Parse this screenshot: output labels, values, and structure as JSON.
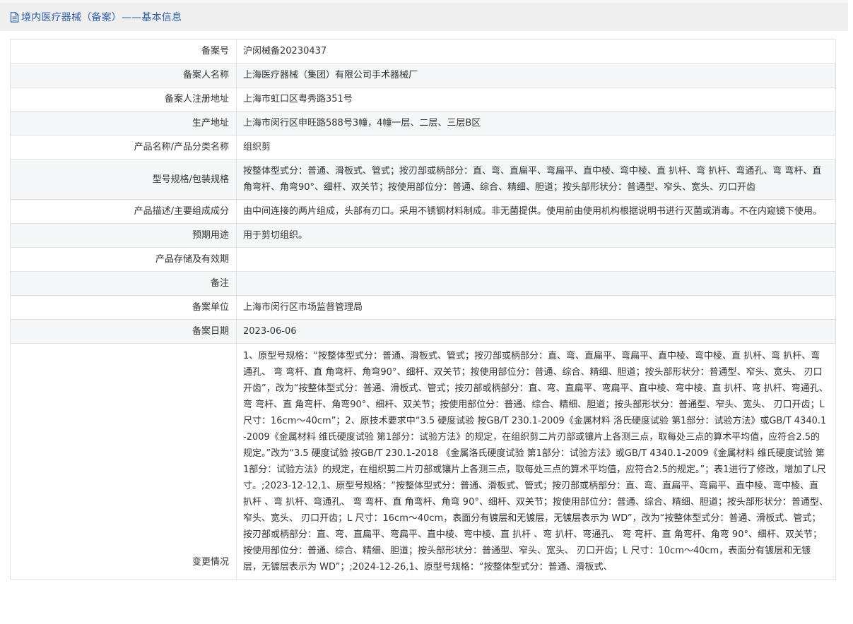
{
  "header": {
    "title": "境内医疗器械（备案）——基本信息",
    "icon": "document-icon"
  },
  "rows": [
    {
      "label": "备案号",
      "value": "沪闵械备20230437"
    },
    {
      "label": "备案人名称",
      "value": "上海医疗器械（集团）有限公司手术器械厂"
    },
    {
      "label": "备案人注册地址",
      "value": "上海市虹口区粤秀路351号"
    },
    {
      "label": "生产地址",
      "value": "上海市闵行区申旺路588号3幢，4幢一层、二层、三层B区"
    },
    {
      "label": "产品名称/产品分类名称",
      "value": "组织剪"
    },
    {
      "label": "型号规格/包装规格",
      "value": "按整体型式分：普通、滑板式、管式；按刃部或柄部分：直、弯、直扁平、弯扁平、直中棱、弯中棱、直 扒杆、弯 扒杆、弯通孔、弯 弯杆、直 角弯杆、角弯90°、细杆、双关节；按使用部位分：普通、综合、精细、胆道；按头部形状分：普通型、窄头、宽头、刃口开齿"
    },
    {
      "label": "产品描述/主要组成成分",
      "value": "由中间连接的两片组成，头部有刃口。采用不锈钢材料制成。非无菌提供。使用前由使用机构根据说明书进行灭菌或消毒。不在内窥镜下使用。"
    },
    {
      "label": "预期用途",
      "value": "用于剪切组织。"
    },
    {
      "label": "产品存储及有效期",
      "value": ""
    },
    {
      "label": "备注",
      "value": ""
    },
    {
      "label": "备案单位",
      "value": "上海市闵行区市场监督管理局"
    },
    {
      "label": "备案日期",
      "value": "2023-06-06"
    }
  ],
  "change": {
    "label": "变更情况",
    "value": "1、原型号规格：“按整体型式分：普通、滑板式、管式；按刃部或柄部分：直、弯、直扁平、弯扁平、直中棱、弯中棱、直 扒杆、弯 扒杆、弯通孔、 弯 弯杆、直 角弯杆、角弯90°、细杆、双关节；按使用部位分：普通、综合、精细、胆道；按头部形状分：普通型、窄头、宽头、 刃口开齿”，改为“按整体型式分：普通、滑板式、管式；按刃部或柄部分：直、弯、直扁平、弯扁平、直中棱、弯中棱、直 扒杆、弯 扒杆、弯通孔、 弯 弯杆、直 角弯杆、角弯90°、细杆、双关节；按使用部位分：普通、综合、精细、胆道；按头部形状分：普通型、窄头、宽头、 刃口开齿；L尺寸：16cm～40cm”；2、原技术要求中“3.5 硬度试验 按GB/T 230.1-2009《金属材料 洛氏硬度试验 第1部分：试验方法》或GB/T 4340.1-2009《金属材料 维氏硬度试验 第1部分：试验方法》的规定，在组织剪二片刃部或镶片上各测三点，取每处三点的算术平均值，应符合2.5的规定。”改为“3.5 硬度试验 按GB/T 230.1-2018 《金属洛氏硬度试验 第1部分：试验方法》或GB/T 4340.1-2009《金属材料 维氏硬度试验 第1部分：试验方法》的规定，在组织剪二片刃部或镶片上各测三点，取每处三点的算术平均值，应符合2.5的规定。”；表1进行了修改，增加了L尺寸。;2023-12-12,1、原型号规格：“按整体型式分：普通、滑板式、管式；按刃部或柄部分：直、弯、直扁平、弯扁平、直中棱、弯中棱、直 扒杆 、弯 扒杆、弯通孔、 弯 弯杆、直 角弯杆、角弯 90°、细杆、双关节；按使用部位分：普通、综合、精细、胆道；按头部形状分：普通型、窄头、宽头、 刃口开齿；L 尺寸：16cm～40cm，表面分有镀层和无镀层，无镀层表示为 WD”，改为“按整体型式分：普通、滑板式、管式；按刃部或柄部分：直、弯、直扁平、弯扁平、直中棱、弯中棱、直 扒杆 、弯 扒杆、弯通孔、 弯 弯杆、直 角弯杆、角弯 90°、细杆、双关节；按使用部位分：普通、综合、精细、胆道；按头部形状分：普通型、窄头、宽头、 刃口开齿；L 尺寸：10cm～40cm，表面分有镀层和无镀层，无镀层表示为 WD”；;2024-12-26,1、原型号规格：“按整体型式分：普通、滑板式、"
  }
}
